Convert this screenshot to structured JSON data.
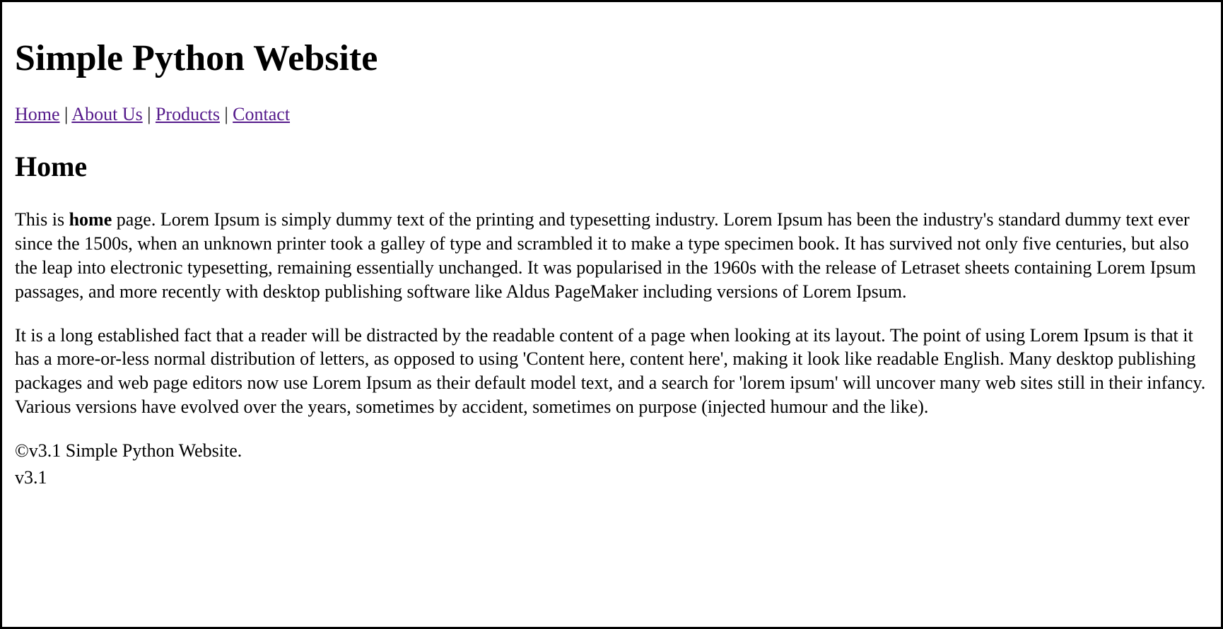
{
  "header": {
    "title": "Simple Python Website"
  },
  "nav": {
    "home": "Home",
    "about": "About Us",
    "products": "Products",
    "contact": "Contact",
    "sep": " | "
  },
  "main": {
    "heading": "Home",
    "p1_prefix": "This is ",
    "p1_bold": "home",
    "p1_rest": " page. Lorem Ipsum is simply dummy text of the printing and typesetting industry. Lorem Ipsum has been the industry's standard dummy text ever since the 1500s, when an unknown printer took a galley of type and scrambled it to make a type specimen book. It has survived not only five centuries, but also the leap into electronic typesetting, remaining essentially unchanged. It was popularised in the 1960s with the release of Letraset sheets containing Lorem Ipsum passages, and more recently with desktop publishing software like Aldus PageMaker including versions of Lorem Ipsum.",
    "p2": "It is a long established fact that a reader will be distracted by the readable content of a page when looking at its layout. The point of using Lorem Ipsum is that it has a more-or-less normal distribution of letters, as opposed to using 'Content here, content here', making it look like readable English. Many desktop publishing packages and web page editors now use Lorem Ipsum as their default model text, and a search for 'lorem ipsum' will uncover many web sites still in their infancy. Various versions have evolved over the years, sometimes by accident, sometimes on purpose (injected humour and the like)."
  },
  "footer": {
    "copyright": "©v3.1 Simple Python Website.",
    "version": "v3.1"
  }
}
